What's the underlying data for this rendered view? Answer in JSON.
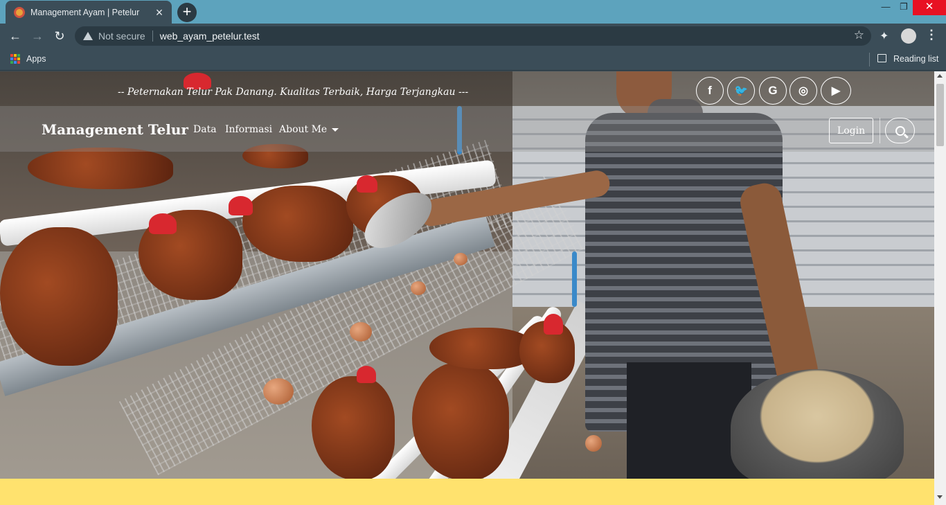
{
  "browser": {
    "tab_title": "Management Ayam | Petelur",
    "new_tab_icon": "plus-icon",
    "not_secure": "Not secure",
    "url": "web_ayam_petelur.test",
    "bookmarks": {
      "apps_label": "Apps",
      "reading_list_label": "Reading list"
    }
  },
  "site": {
    "tagline": "-- Peternakan Telur Pak Danang. Kualitas Terbaik, Harga Terjangkau ---",
    "brand": "Management Telur",
    "nav": {
      "data": "Data",
      "informasi": "Informasi",
      "about": "About Me"
    },
    "login_label": "Login",
    "social": {
      "facebook": "f",
      "twitter": "🐦",
      "google": "G",
      "instagram": "◎",
      "youtube": "▶"
    },
    "accent_band_color": "#ffe26e"
  }
}
